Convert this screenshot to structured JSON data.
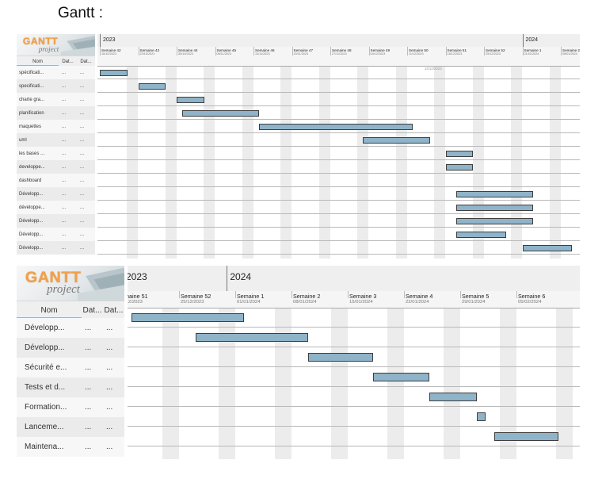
{
  "heading": "Gantt :",
  "logo": {
    "word": "GANTT",
    "sub": "project"
  },
  "chart1": {
    "columns": {
      "name": "Nom",
      "c2": "Dat...",
      "c3": "Dat..."
    },
    "years": [
      {
        "label": "2023",
        "week": 0
      },
      {
        "label": "2024",
        "week": 11
      }
    ],
    "weeks": [
      {
        "name": "Semaine 42",
        "date": "16/10/2023"
      },
      {
        "name": "Semaine 43",
        "date": "23/10/2023"
      },
      {
        "name": "Semaine 44",
        "date": "30/10/2023"
      },
      {
        "name": "Semaine 45",
        "date": "06/11/2023"
      },
      {
        "name": "Semaine 46",
        "date": "13/11/2023"
      },
      {
        "name": "Semaine 47",
        "date": "20/11/2023"
      },
      {
        "name": "Semaine 48",
        "date": "27/11/2023"
      },
      {
        "name": "Semaine 49",
        "date": "04/12/2023"
      },
      {
        "name": "Semaine 50",
        "date": "11/12/2023"
      },
      {
        "name": "Semaine 51",
        "date": "18/12/2023"
      },
      {
        "name": "Semaine 52",
        "date": "25/12/2023"
      },
      {
        "name": "Semaine 1",
        "date": "01/01/2024"
      },
      {
        "name": "Semaine 2",
        "date": "08/01/2024"
      }
    ],
    "today": {
      "label": "14/12/2023",
      "week": 8.45
    },
    "tasks": [
      {
        "name": "spécificati...",
        "c2": "...",
        "c3": "...",
        "start": 0.0,
        "end": 0.72
      },
      {
        "name": "specificati...",
        "c2": "...",
        "c3": "...",
        "start": 1.0,
        "end": 1.72
      },
      {
        "name": "charte gra...",
        "c2": "...",
        "c3": "...",
        "start": 2.0,
        "end": 2.72
      },
      {
        "name": "planification",
        "c2": "...",
        "c3": "...",
        "start": 2.15,
        "end": 4.15
      },
      {
        "name": "maquettes",
        "c2": "...",
        "c3": "...",
        "start": 4.15,
        "end": 8.15
      },
      {
        "name": "uml",
        "c2": "...",
        "c3": "...",
        "start": 6.85,
        "end": 8.6
      },
      {
        "name": "les bases ...",
        "c2": "...",
        "c3": "...",
        "start": 9.0,
        "end": 9.72
      },
      {
        "name": "developpe...",
        "c2": "...",
        "c3": "...",
        "start": 9.0,
        "end": 9.72
      },
      {
        "name": "dashboard",
        "c2": "...",
        "c3": "...",
        "start": null,
        "end": null
      },
      {
        "name": "Développ...",
        "c2": "...",
        "c3": "...",
        "start": 9.28,
        "end": 11.28
      },
      {
        "name": "développe...",
        "c2": "...",
        "c3": "...",
        "start": 9.28,
        "end": 11.28
      },
      {
        "name": "Développ...",
        "c2": "...",
        "c3": "...",
        "start": 9.28,
        "end": 11.28
      },
      {
        "name": "Développ...",
        "c2": "...",
        "c3": "...",
        "start": 9.28,
        "end": 10.57
      },
      {
        "name": "Développ...",
        "c2": "...",
        "c3": "...",
        "start": 11.0,
        "end": 12.28
      }
    ]
  },
  "chart2": {
    "columns": {
      "name": "Nom",
      "c2": "Dat...",
      "c3": "Dat..."
    },
    "years": [
      {
        "label": "2023",
        "week": 0
      },
      {
        "label": "2024",
        "week": 1.85
      }
    ],
    "weeks": [
      {
        "name": "maine 51",
        "date": "/12/2023"
      },
      {
        "name": "Semaine 52",
        "date": "25/12/2023"
      },
      {
        "name": "Semaine 1",
        "date": "01/01/2024"
      },
      {
        "name": "Semaine 2",
        "date": "08/01/2024"
      },
      {
        "name": "Semaine 3",
        "date": "15/01/2024"
      },
      {
        "name": "Semaine 4",
        "date": "22/01/2024"
      },
      {
        "name": "Semaine 5",
        "date": "29/01/2024"
      },
      {
        "name": "Semaine 6",
        "date": "05/02/2024"
      }
    ],
    "tasks": [
      {
        "name": "Développ...",
        "c2": "...",
        "c3": "...",
        "start": 0.15,
        "end": 2.15
      },
      {
        "name": "Développ...",
        "c2": "...",
        "c3": "...",
        "start": 1.3,
        "end": 3.3
      },
      {
        "name": "Sécurité e...",
        "c2": "...",
        "c3": "...",
        "start": 3.3,
        "end": 4.45
      },
      {
        "name": "Tests et d...",
        "c2": "...",
        "c3": "...",
        "start": 4.45,
        "end": 5.45
      },
      {
        "name": "Formation...",
        "c2": "...",
        "c3": "...",
        "start": 5.45,
        "end": 6.3
      },
      {
        "name": "Lanceme...",
        "c2": "...",
        "c3": "...",
        "start": 6.3,
        "end": 6.45
      },
      {
        "name": "Maintena...",
        "c2": "...",
        "c3": "...",
        "start": 6.6,
        "end": 7.75
      }
    ]
  },
  "colors": {
    "bar": "#8fb3c8",
    "bar_border": "#3e3e3e",
    "header_bg": "#efefef",
    "row_alt": "#ebebeb",
    "logo_orange": "#f2a04a"
  }
}
